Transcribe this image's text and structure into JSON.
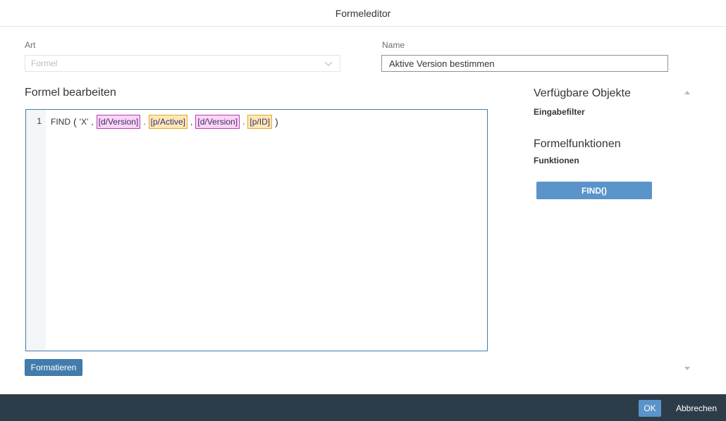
{
  "dialog": {
    "title": "Formeleditor"
  },
  "fields": {
    "art_label": "Art",
    "art_value": "Formel",
    "name_label": "Name",
    "name_value": "Aktive Version bestimmen"
  },
  "editor": {
    "section_title": "Formel bearbeiten",
    "line_number": "1",
    "tokens": {
      "func": "FIND",
      "open": "(",
      "literal": "'X'",
      "comma1": ",",
      "dim1": "[d/Version]",
      "dot1": ".",
      "prop1": "[p/Active]",
      "comma2": ",",
      "dim2": "[d/Version]",
      "dot2": ".",
      "prop2": "[p/ID]",
      "close": ")"
    },
    "format_button": "Formatieren"
  },
  "side_panel": {
    "objects_title": "Verfügbare Objekte",
    "input_filter_label": "Eingabefilter",
    "functions_title": "Formelfunktionen",
    "functions_label": "Funktionen",
    "find_button": "FIND()"
  },
  "footer": {
    "ok_label": "OK",
    "cancel_label": "Abbrechen"
  },
  "colors": {
    "accent": "#427cac",
    "footer_bg": "#2d3c49",
    "dimension_chip_bg": "#f9d6f5",
    "property_chip_bg": "#fde9b6"
  },
  "icons": {
    "dropdown": "chevron-down-icon",
    "scroll_up": "caret-up-icon",
    "scroll_down": "caret-down-icon"
  }
}
